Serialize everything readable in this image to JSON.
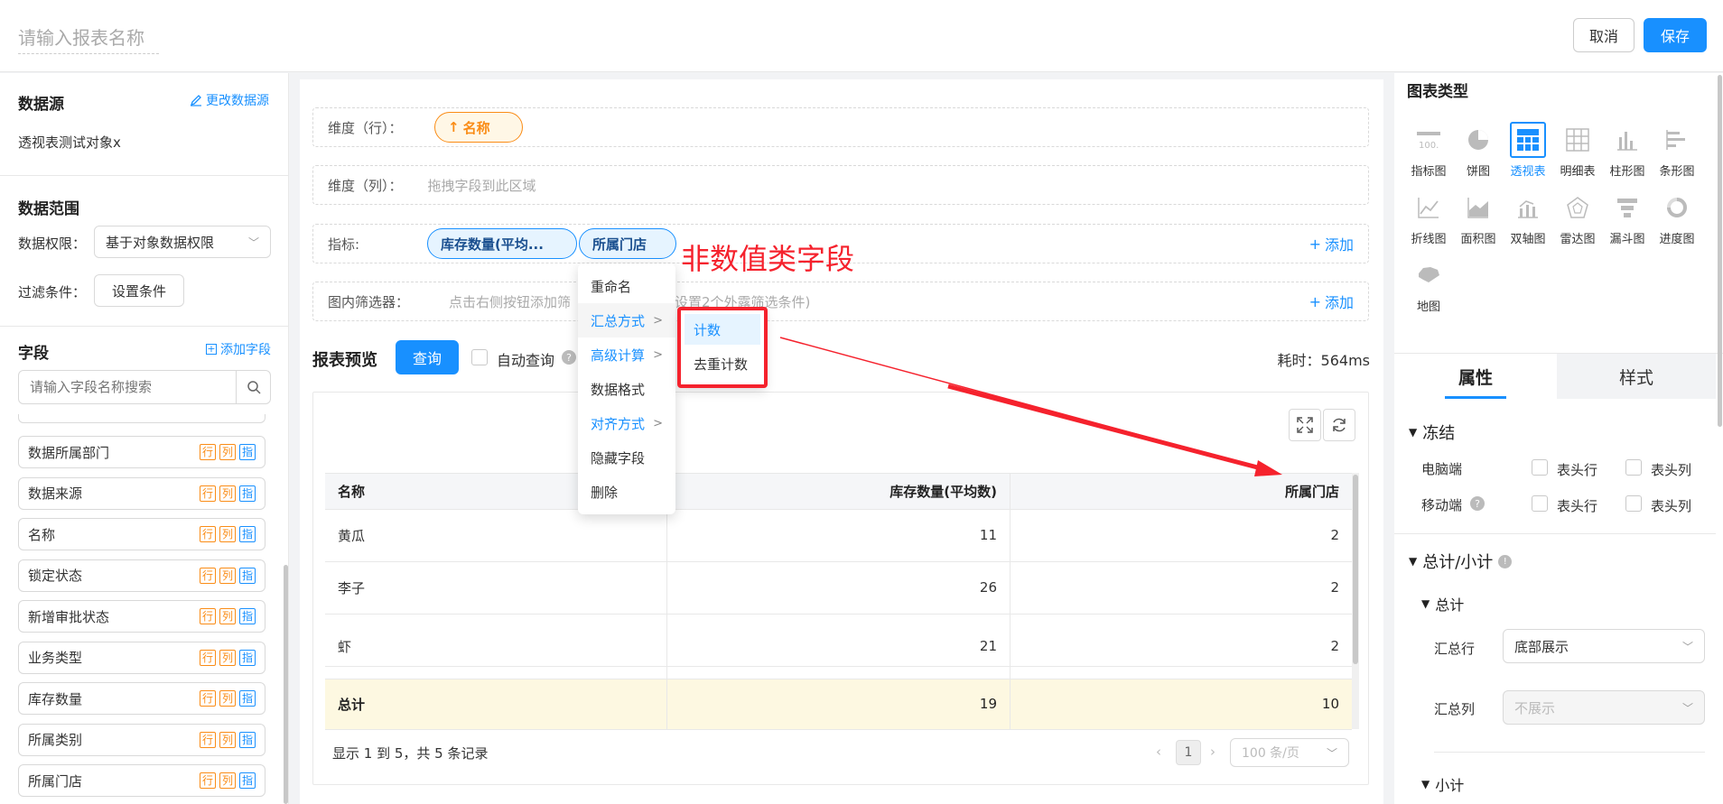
{
  "header": {
    "report_name_placeholder": "请输入报表名称",
    "cancel_label": "取消",
    "save_label": "保存"
  },
  "left": {
    "datasource_title": "数据源",
    "change_datasource": "更改数据源",
    "datasource_name": "透视表测试对象x",
    "range_title": "数据范围",
    "permission_label": "数据权限：",
    "permission_value": "基于对象数据权限",
    "filter_label": "过滤条件：",
    "filter_button": "设置条件",
    "fields_title": "字段",
    "add_field": "添加字段",
    "search_placeholder": "请输入字段名称搜索",
    "tag_row": "行",
    "tag_col": "列",
    "tag_metric": "指",
    "fields": [
      "数据所属部门",
      "数据来源",
      "名称",
      "锁定状态",
      "新增审批状态",
      "业务类型",
      "库存数量",
      "所属类别",
      "所属门店"
    ]
  },
  "center": {
    "dim_row_label": "维度（行）：",
    "dim_row_pill": "名称",
    "dim_col_label": "维度（列）：",
    "dim_col_placeholder": "拖拽字段到此区域",
    "metric_label": "指标:",
    "metric_pill_1": "库存数量(平均...",
    "metric_pill_2": "所属门店",
    "add_label": "添加",
    "filter_label": "图内筛选器：",
    "filter_placeholder_left": "点击右侧按钮添加筛",
    "filter_placeholder_right": "设置2个外露筛选条件)",
    "annotation": "非数值类字段",
    "preview_title": "报表预览",
    "query_button": "查询",
    "auto_query": "自动查询",
    "elapsed": "耗时：564ms",
    "table": {
      "headers": [
        "名称",
        "库存数量(平均数)",
        "所属门店"
      ],
      "rows": [
        [
          "黄瓜",
          "11",
          "2"
        ],
        [
          "李子",
          "26",
          "2"
        ],
        [
          "虾",
          "21",
          "2"
        ]
      ],
      "total": [
        "总计",
        "19",
        "10"
      ]
    },
    "pagination": {
      "summary": "显示 1 到 5，共 5 条记录",
      "page": "1",
      "page_size": "100 条/页"
    }
  },
  "context_menu": {
    "items": [
      "重命名",
      "汇总方式",
      "高级计算",
      "数据格式",
      "对齐方式",
      "隐藏字段",
      "删除"
    ],
    "submenu": [
      "计数",
      "去重计数"
    ]
  },
  "right": {
    "chart_type_title": "图表类型",
    "chart_types": [
      "指标图",
      "饼图",
      "透视表",
      "明细表",
      "柱形图",
      "条形图",
      "折线图",
      "面积图",
      "双轴图",
      "雷达图",
      "漏斗图",
      "进度图",
      "地图"
    ],
    "tab_props": "属性",
    "tab_style": "样式",
    "freeze_title": "冻结",
    "desktop_label": "电脑端",
    "mobile_label": "移动端",
    "header_row": "表头行",
    "header_col": "表头列",
    "total_sub_title": "总计/小计",
    "total_title": "总计",
    "total_row_label": "汇总行",
    "total_row_value": "底部展示",
    "total_col_label": "汇总列",
    "total_col_value": "不展示",
    "subtotal_title": "小计"
  },
  "colors": {
    "accent": "#1890ff",
    "orange": "#fa8c16",
    "annotation_red": "#f5222d",
    "total_row_bg": "#fdf8e1"
  }
}
